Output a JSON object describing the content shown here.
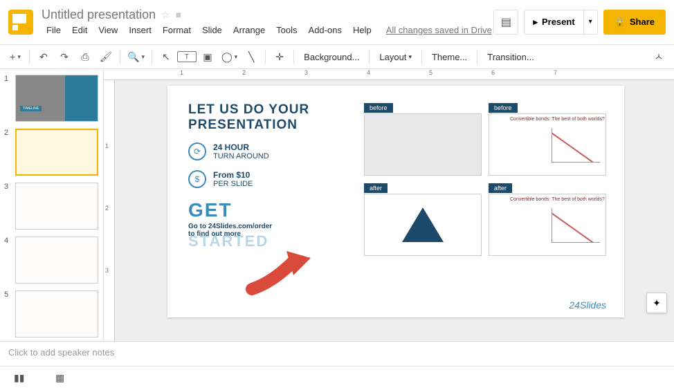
{
  "header": {
    "doc_title": "Untitled presentation",
    "menus": [
      "File",
      "Edit",
      "View",
      "Insert",
      "Format",
      "Slide",
      "Arrange",
      "Tools",
      "Add-ons",
      "Help"
    ],
    "save_status": "All changes saved in Drive",
    "present_label": "Present",
    "share_label": "Share"
  },
  "toolbar": {
    "background": "Background...",
    "layout": "Layout",
    "theme": "Theme...",
    "transition": "Transition..."
  },
  "ruler": {
    "h": [
      "1",
      "2",
      "3",
      "4",
      "5",
      "6",
      "7"
    ],
    "v": [
      "1",
      "2",
      "3"
    ]
  },
  "thumbnails": {
    "count": 5,
    "selected": 2,
    "t1_label": "TIMELINE"
  },
  "slide": {
    "title_line1": "LET US DO YOUR",
    "title_line2": "PRESENTATION",
    "feat1_bold": "24 HOUR",
    "feat1_sub": "TURN AROUND",
    "feat2_bold": "From $10",
    "feat2_sub": "PER SLIDE",
    "get": "GET",
    "link": "Go to 24Slides.com/order",
    "link2": "to find out more",
    "started_overlay": "STARTED",
    "before": "before",
    "after": "after",
    "ex2_title": "Convertible bonds: The best of both worlds?",
    "brand": "24Slides"
  },
  "notes": {
    "placeholder": "Click to add speaker notes"
  }
}
